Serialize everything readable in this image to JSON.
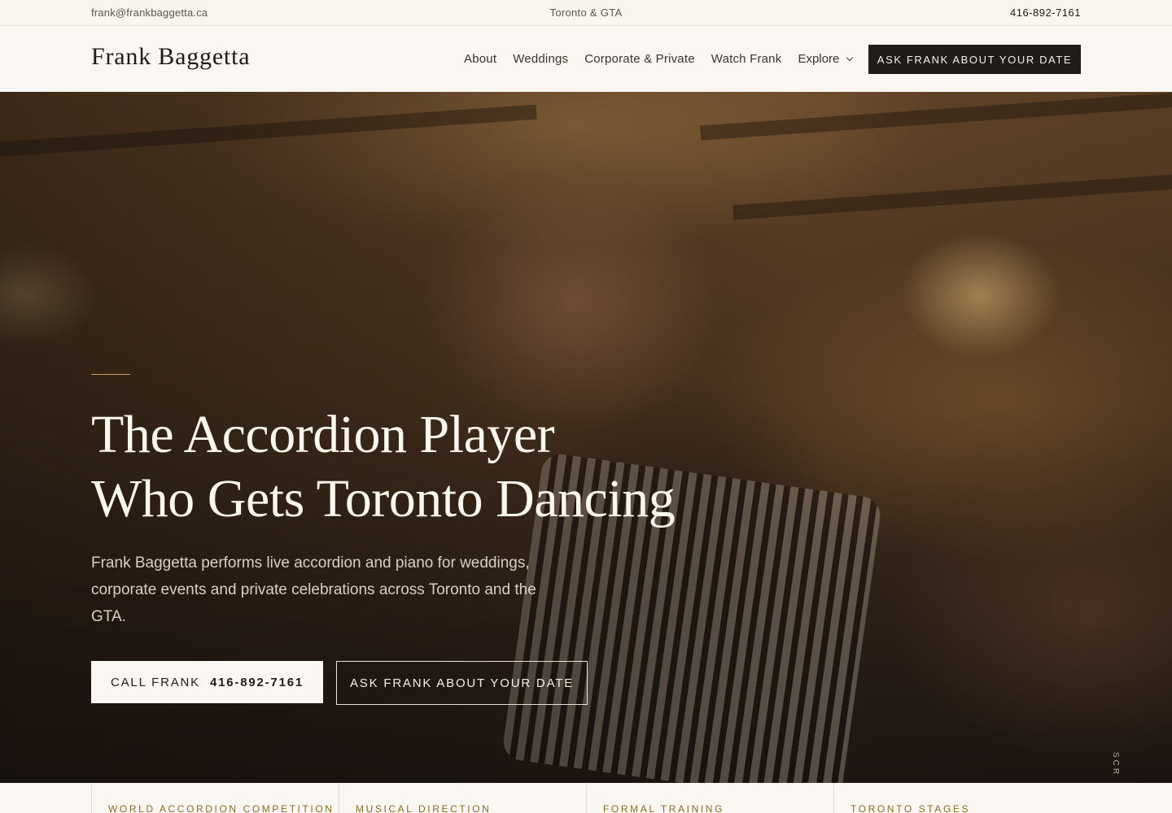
{
  "topbar": {
    "email": "frank@frankbaggetta.ca",
    "location": "Toronto & GTA",
    "phone": "416-892-7161"
  },
  "header": {
    "logo": "Frank Baggetta",
    "nav": [
      "About",
      "Weddings",
      "Corporate & Private",
      "Watch Frank"
    ],
    "explore": "Explore",
    "cta": "ASK FRANK ABOUT YOUR DATE"
  },
  "hero": {
    "title_line1": "The Accordion Player",
    "title_line2": "Who Gets Toronto Dancing",
    "lede": "Frank Baggetta performs live accordion and piano for weddings, corporate events and private celebrations across Toronto and the GTA.",
    "call_label": "CALL FRANK",
    "call_number": "416-892-7161",
    "ask_label": "ASK FRANK ABOUT YOUR DATE",
    "scroll": "SCR"
  },
  "credentials": [
    "WORLD ACCORDION COMPETITION",
    "MUSICAL DIRECTION",
    "FORMAL TRAINING",
    "TORONTO STAGES"
  ],
  "colors": {
    "accent_gold": "#c9a35c",
    "dark_button": "#1f1c1a",
    "cream": "#faf7f2"
  }
}
